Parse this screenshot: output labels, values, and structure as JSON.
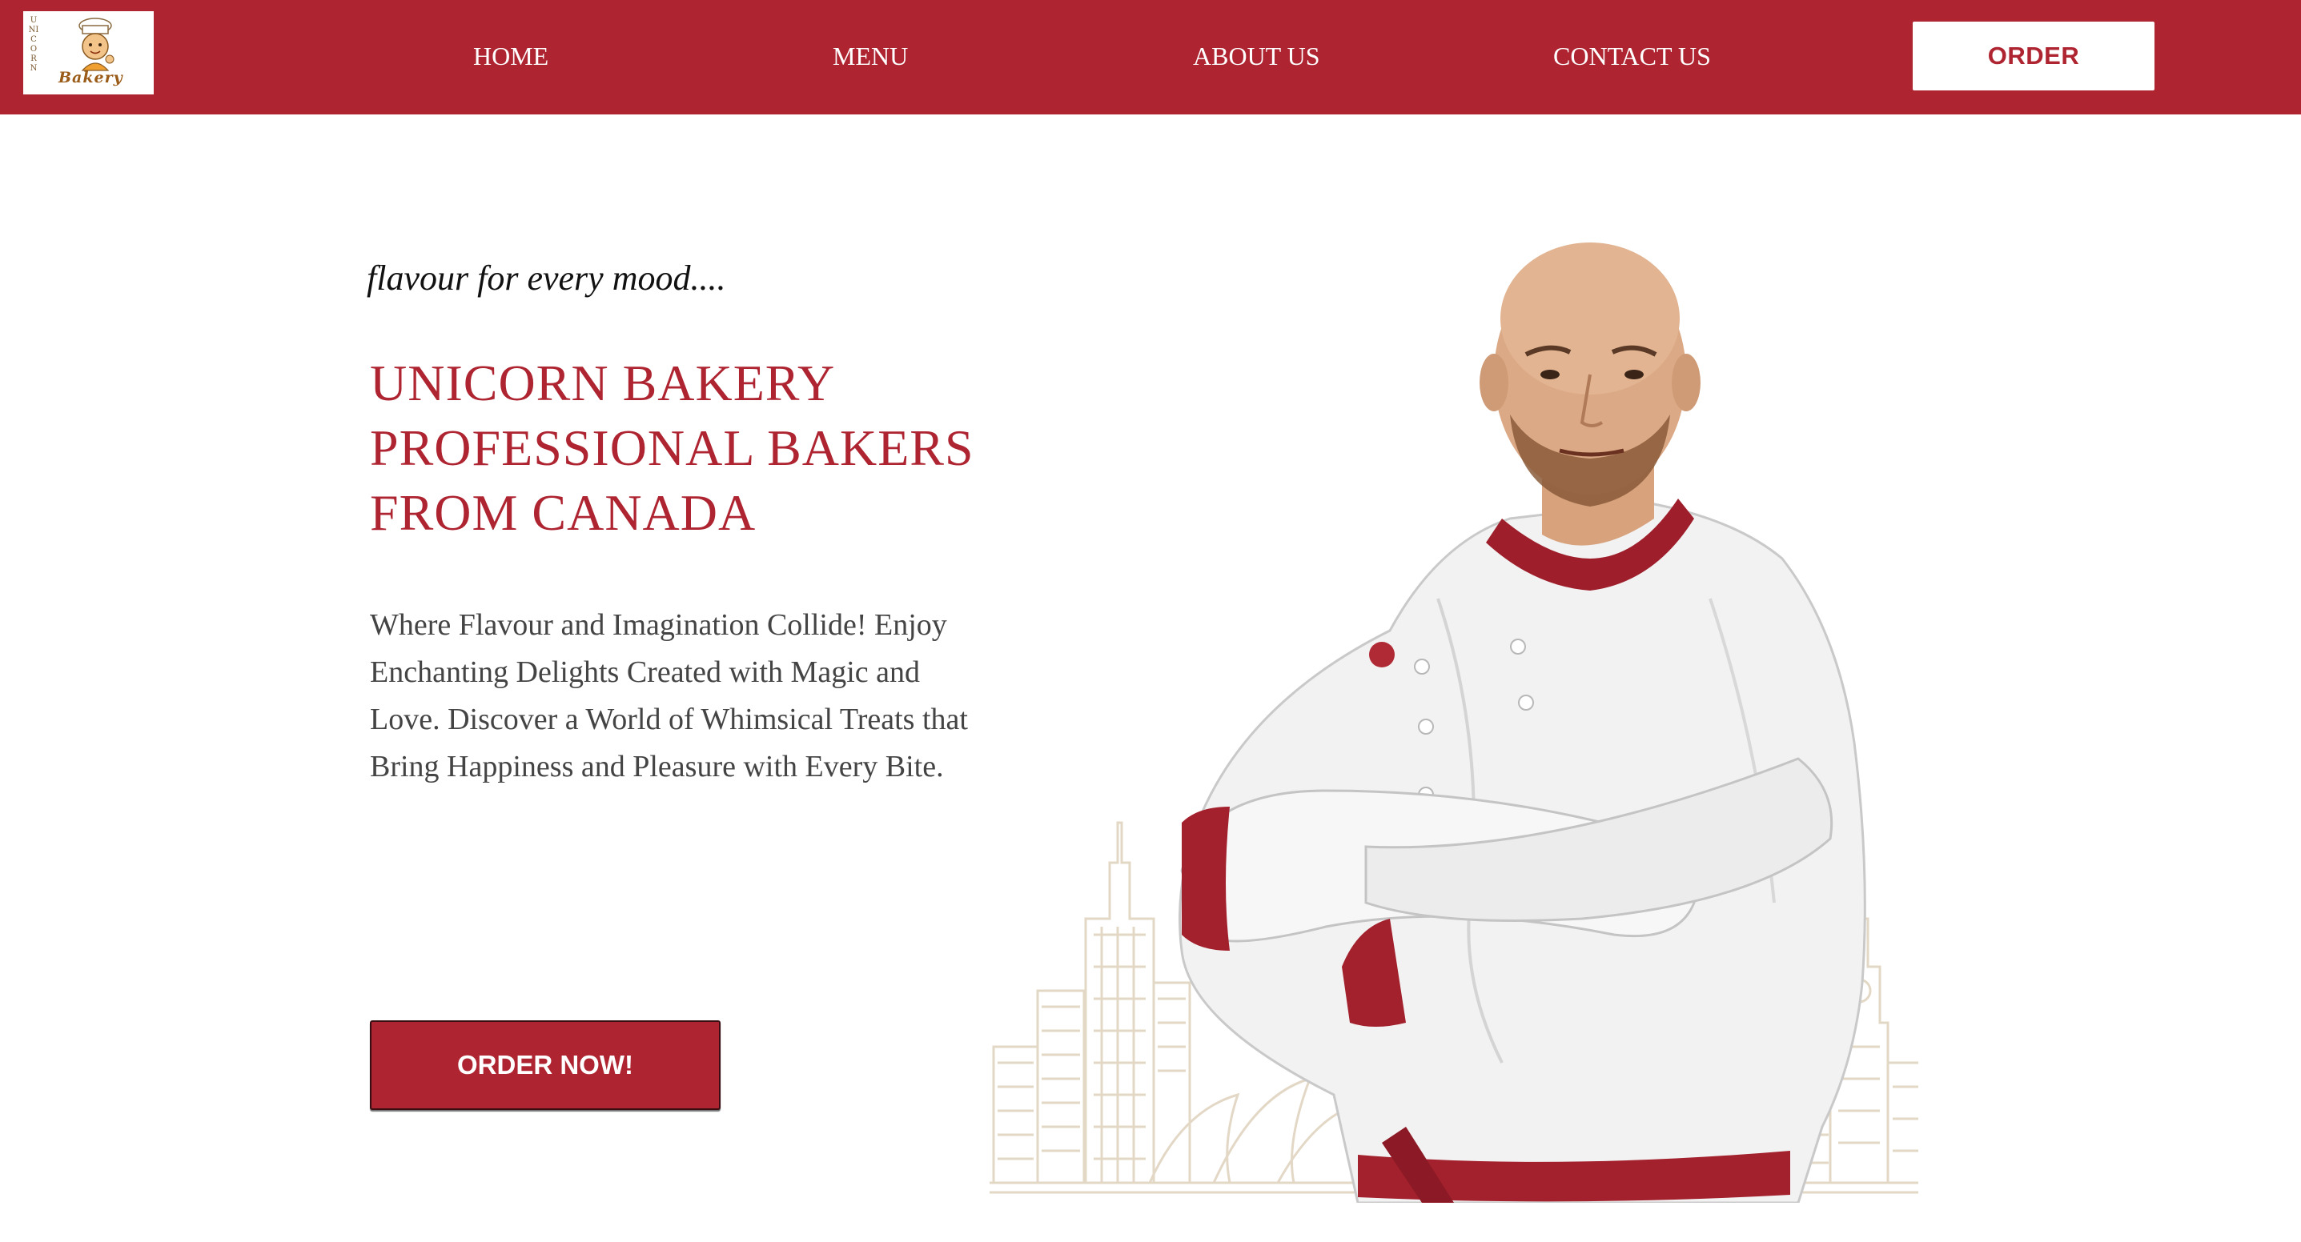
{
  "brand": {
    "logo_text": "UNICORN",
    "logo_wordmark": "Bakery"
  },
  "nav": {
    "items": [
      {
        "label": "HOME"
      },
      {
        "label": "MENU"
      },
      {
        "label": "ABOUT US"
      },
      {
        "label": "CONTACT US"
      }
    ],
    "order_label": "ORDER"
  },
  "hero": {
    "tagline": "flavour for every mood....",
    "headline_lines": [
      "UNICORN BAKERY",
      "PROFESSIONAL BAKERS",
      "FROM CANADA"
    ],
    "description_lines": [
      "Where Flavour and Imagination Collide! Enjoy",
      "Enchanting Delights Created with Magic and",
      "Love. Discover a World of Whimsical Treats that",
      "Bring Happiness and Pleasure with Every Bite."
    ],
    "cta_label": "ORDER NOW!"
  },
  "colors": {
    "brand_red": "#ae2431",
    "text_dark": "#111111",
    "text_body": "#444444",
    "white": "#ffffff"
  },
  "icons": {
    "logo": "baker-mascot-logo",
    "hero": "chef-with-skyline-illustration"
  }
}
